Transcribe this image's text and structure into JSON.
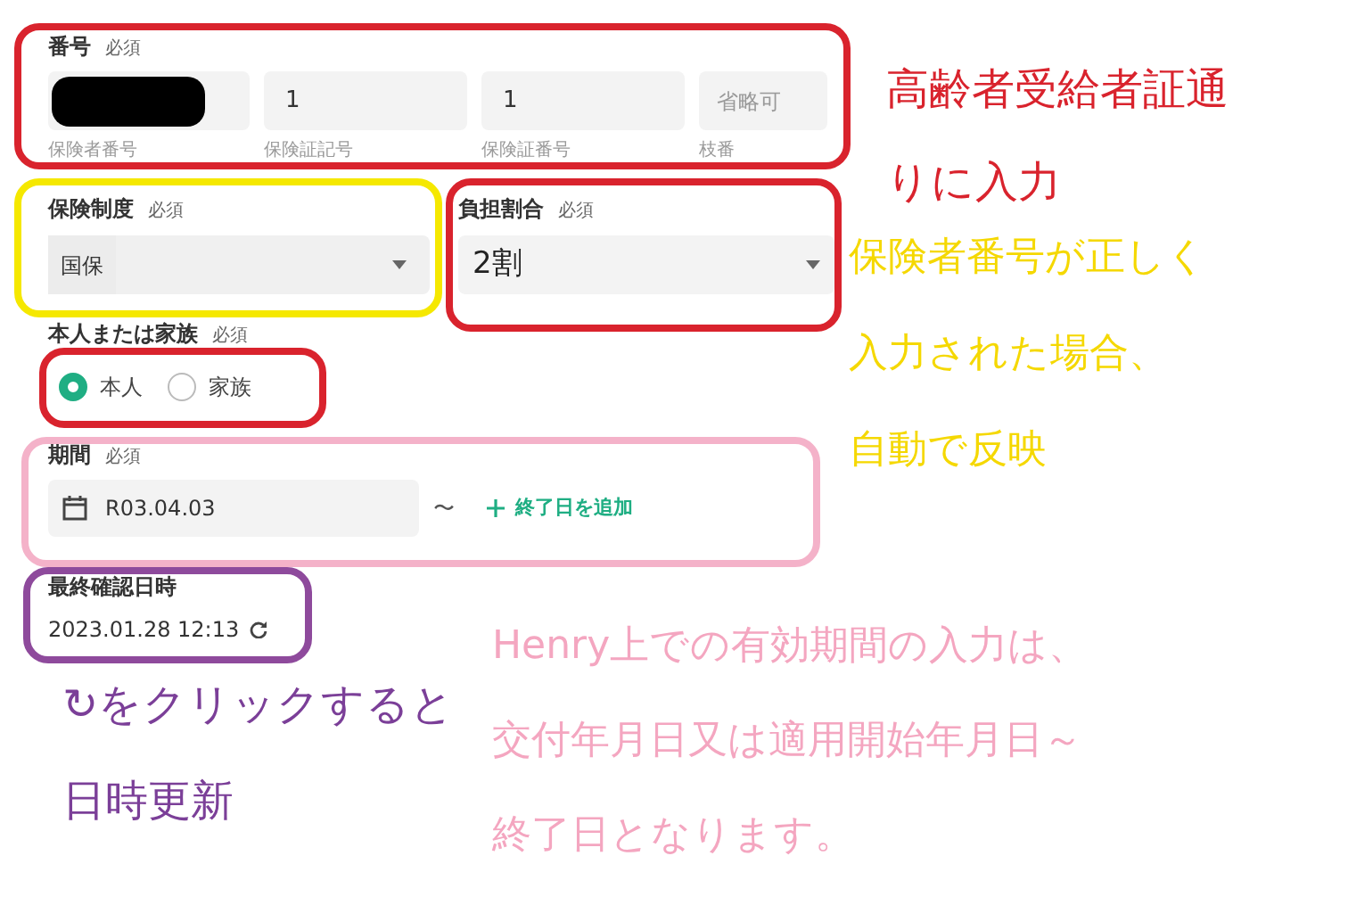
{
  "number_section": {
    "label": "番号",
    "required": "必須",
    "fields": [
      {
        "kind": "redacted",
        "sublabel": "保険者番号"
      },
      {
        "kind": "value",
        "value": "1",
        "sublabel": "保険証記号"
      },
      {
        "kind": "value",
        "value": "1",
        "sublabel": "保険証番号"
      },
      {
        "kind": "placeholder",
        "placeholder": "省略可",
        "sublabel": "枝番"
      }
    ]
  },
  "insurance_system": {
    "label": "保険制度",
    "required": "必須",
    "prefix": "国保"
  },
  "burden_ratio": {
    "label": "負担割合",
    "required": "必須",
    "value": "2割"
  },
  "person": {
    "label": "本人または家族",
    "required": "必須",
    "options": [
      {
        "label": "本人",
        "selected": true
      },
      {
        "label": "家族",
        "selected": false
      }
    ]
  },
  "period": {
    "label": "期間",
    "required": "必須",
    "start": "R03.04.03",
    "separator": "〜",
    "add_end": "終了日を追加"
  },
  "last_checked": {
    "label": "最終確認日時",
    "value": "2023.01.28 12:13"
  },
  "frames": [
    {
      "color": "#d9232d"
    },
    {
      "color": "#f5e800"
    },
    {
      "color": "#d9232d"
    },
    {
      "color": "#d9232d"
    },
    {
      "color": "#f4b2c9"
    },
    {
      "color": "#8e4a9c"
    }
  ],
  "notes": [
    {
      "color": "#d9232d",
      "lines": [
        "高齢者受給者証通",
        "りに入力"
      ]
    },
    {
      "color": "#f5d800",
      "lines": [
        "保険者番号が正しく",
        "入力された場合、",
        "自動で反映"
      ]
    },
    {
      "color": "#7b3f98",
      "lines": [
        "↻をクリックすると",
        "日時更新"
      ]
    },
    {
      "color": "#f4a6c0",
      "lines": [
        "Henry上での有効期間の入力は、",
        "交付年月日又は適用開始年月日～",
        "終了日となります。"
      ]
    }
  ]
}
